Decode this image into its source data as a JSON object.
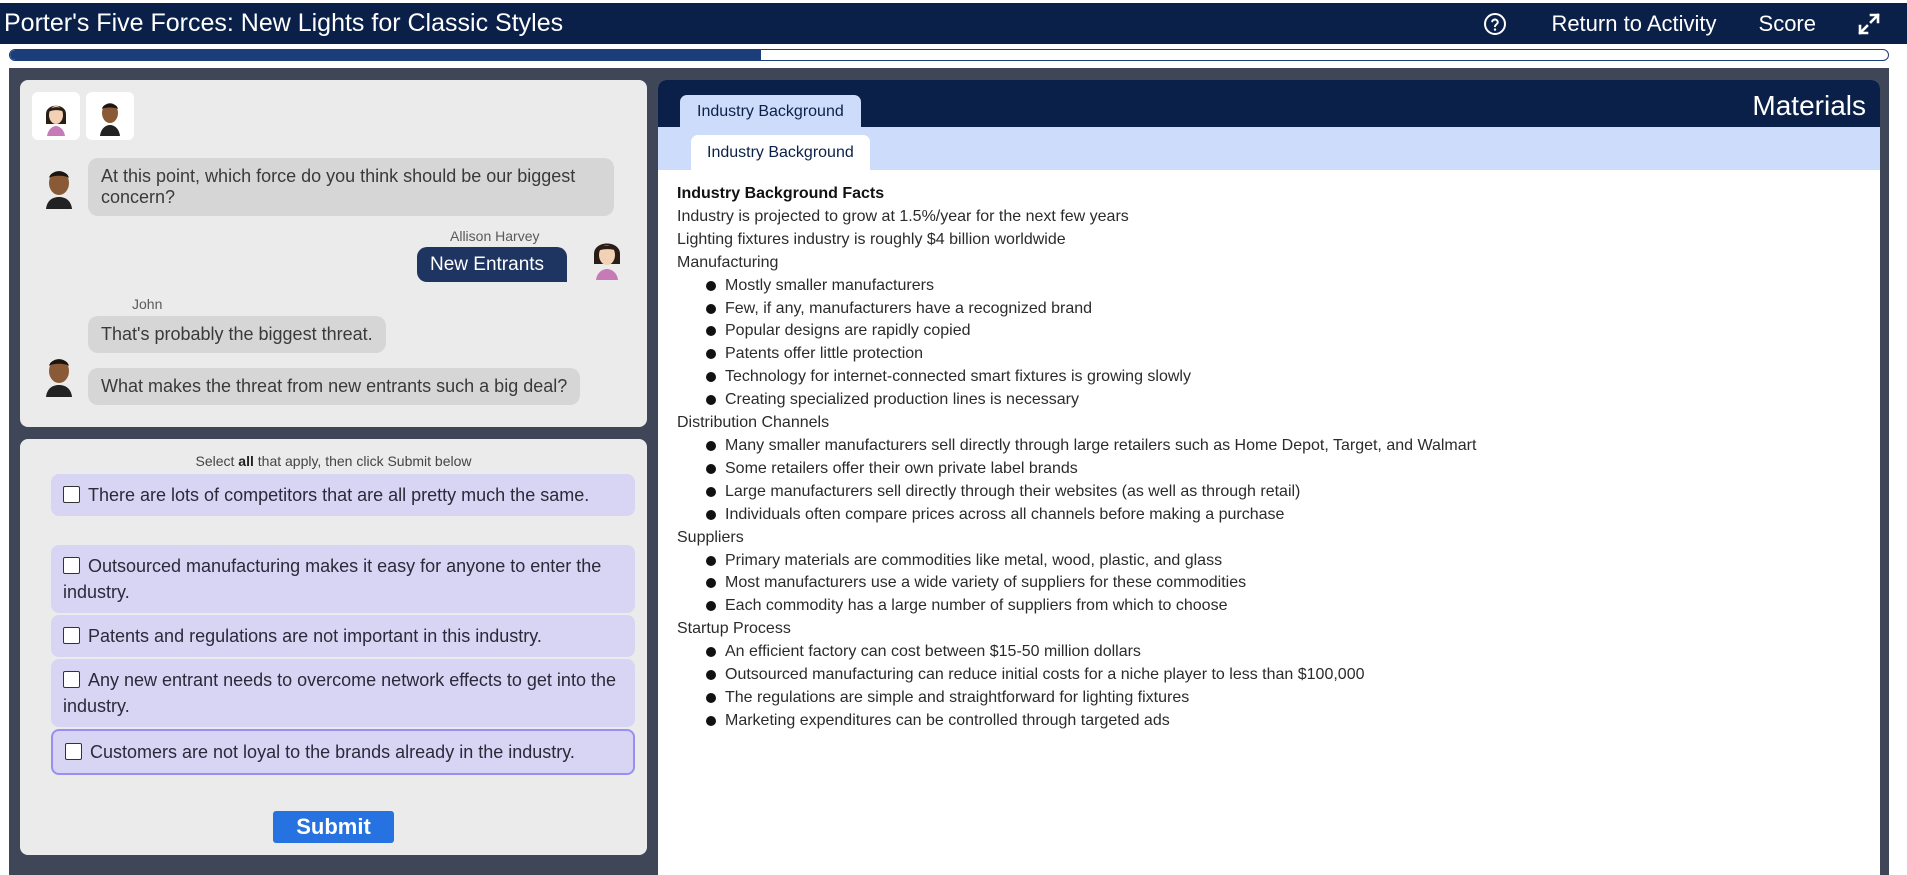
{
  "app": {
    "title": "Porter's Five Forces: New Lights for Classic Styles",
    "return_label": "Return to Activity",
    "score_label": "Score",
    "progress_fraction": 0.4
  },
  "chat": {
    "messages": {
      "m1": "At this point, which force do you think should be our biggest concern?",
      "allison_name": "Allison Harvey",
      "m2": "New Entrants",
      "john_name": "John",
      "m3": "That's probably the biggest threat.",
      "m4": "What makes the threat from new entrants such a big deal?"
    }
  },
  "question": {
    "instruction_pre": "Select ",
    "instruction_bold": "all",
    "instruction_post": " that apply, then click Submit below",
    "options": [
      "There are lots of competitors that are all pretty much the same.",
      "Outsourced manufacturing makes it easy for anyone to enter the industry.",
      "Patents and regulations are not important in this industry.",
      "Any new entrant needs to overcome network effects to get into the industry.",
      "Customers are not loyal to the brands already in the industry."
    ],
    "submit_label": "Submit"
  },
  "materials": {
    "title": "Materials",
    "tab_label": "Industry Background",
    "subtab_label": "Industry Background",
    "facts_title": "Industry Background Facts",
    "line1": "Industry is projected to grow at 1.5%/year for the next few years",
    "line2": "Lighting fixtures industry is roughly $4 billion worldwide",
    "sections": [
      {
        "heading": "Manufacturing",
        "items": [
          "Mostly smaller manufacturers",
          "Few, if any, manufacturers have a recognized brand",
          "Popular designs are rapidly copied",
          "Patents offer little protection",
          "Technology for internet-connected smart fixtures is growing slowly",
          "Creating specialized production lines is necessary"
        ]
      },
      {
        "heading": "Distribution Channels",
        "items": [
          "Many smaller manufacturers sell directly through large retailers such as Home Depot, Target, and Walmart",
          "Some retailers offer their own private label brands",
          "Large manufacturers sell directly through their websites (as well as through retail)",
          "Individuals often compare prices across all channels before making a purchase"
        ]
      },
      {
        "heading": "Suppliers",
        "items": [
          "Primary materials are commodities like metal, wood, plastic, and glass",
          "Most manufacturers use a wide variety of suppliers for these commodities",
          "Each commodity has a large number of suppliers from which to choose"
        ]
      },
      {
        "heading": "Startup Process",
        "items": [
          "An efficient factory can cost between $15-50 million dollars",
          "Outsourced manufacturing can reduce initial costs for a niche player to less than $100,000",
          "The regulations are simple and straightforward for lighting fixtures",
          "Marketing expenditures can be controlled through targeted ads"
        ]
      }
    ]
  },
  "colors": {
    "header_bg": "#0b2048",
    "accent_blue": "#2672e0",
    "option_bg": "#d8d4f3",
    "tab_bg": "#cddcfa"
  },
  "icons": [
    "help-icon",
    "expand-icon",
    "avatar-female",
    "avatar-male"
  ]
}
